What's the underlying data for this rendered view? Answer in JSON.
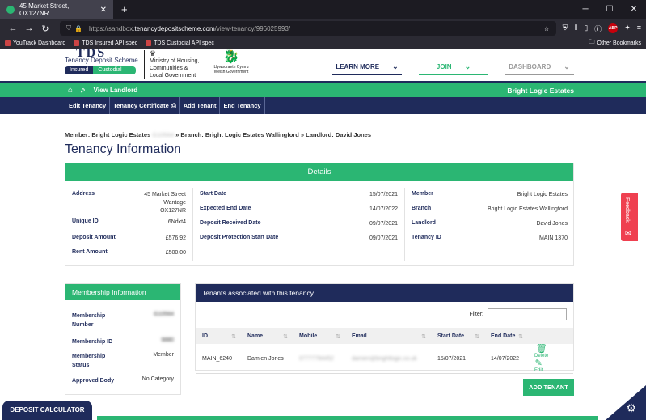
{
  "browser": {
    "tab_title": "45 Market Street, OX127NR",
    "tab_close": "✕",
    "new_tab": "+",
    "url_prefix": "https://sandbox.",
    "url_host": "tenancydepositscheme.com",
    "url_path": "/view-tenancy/996025993/",
    "bookmarks": [
      "YouTrack Dashboard",
      "TDS Insured API spec",
      "TDS Custodial API spec"
    ],
    "other_bookmarks": "Other Bookmarks"
  },
  "header": {
    "logo_text": "TDS",
    "logo_sub": "Tenancy Deposit Scheme",
    "insured": "Insured",
    "custodial": "Custodial",
    "gov_lines": [
      "Ministry of Housing,",
      "Communities &",
      "Local Government"
    ],
    "welsh_lines": [
      "Llywodraeth Cymru",
      "Welsh Government"
    ],
    "nav": {
      "learn": "LEARN MORE",
      "join": "JOIN",
      "dashboard": "DASHBOARD"
    }
  },
  "greenbar": {
    "view_landlord": "View Landlord",
    "brand": "Bright Logic Estates"
  },
  "actions": {
    "edit": "Edit Tenancy",
    "certificate": "Tenancy Certificate",
    "add": "Add Tenant",
    "end": "End Tenancy"
  },
  "breadcrumb": {
    "member_label": "Member: Bright Logic Estates",
    "member_id": "G10564",
    "branch": "» Branch: Bright Logic Estates Wallingford",
    "landlord": "» Landlord: David Jones"
  },
  "page_title": "Tenancy Information",
  "details": {
    "title": "Details",
    "address_label": "Address",
    "address_lines": [
      "45 Market Street",
      "Wantage",
      "OX127NR"
    ],
    "uid_label": "Unique ID",
    "uid": "6Ndxt4",
    "deposit_label": "Deposit Amount",
    "deposit": "£576.92",
    "rent_label": "Rent Amount",
    "rent": "£500.00",
    "start_label": "Start Date",
    "start": "15/07/2021",
    "expected_label": "Expected End Date",
    "expected": "14/07/2022",
    "received_label": "Deposit Received Date",
    "received": "09/07/2021",
    "protection_label": "Deposit Protection Start Date",
    "protection": "09/07/2021",
    "member_label": "Member",
    "member": "Bright Logic Estates",
    "branch_label": "Branch",
    "branch": "Bright Logic Estates Wallingford",
    "landlord_label": "Landlord",
    "landlord": "David Jones",
    "tenancy_label": "Tenancy ID",
    "tenancy": "MAIN 1370"
  },
  "membership": {
    "title": "Membership Information",
    "number_label_1": "Membership",
    "number_label_2": "Number",
    "number": "G10564",
    "id_label": "Membership ID",
    "id": "9880",
    "status_label_1": "Membership",
    "status_label_2": "Status",
    "status": "Member",
    "approved_label": "Approved Body",
    "approved": "No Category"
  },
  "tenants": {
    "title": "Tenants associated with this tenancy",
    "filter_label": "Filter:",
    "filter_value": "",
    "columns": [
      "ID",
      "Name",
      "Mobile",
      "Email",
      "Start Date",
      "End Date"
    ],
    "rows": [
      {
        "id": "MAIN_6240",
        "name": "Damien Jones",
        "mobile": "07777784452",
        "email": "damien@brightlogic.co.uk",
        "start": "15/07/2021",
        "end": "14/07/2022"
      }
    ],
    "delete": "Delete",
    "edit": "Edit",
    "add_button": "ADD TENANT"
  },
  "deposit_calculator": "DEPOSIT CALCULATOR",
  "feedback": "Feedback",
  "colors": {
    "green": "#2bb673",
    "navy": "#1f2b5b"
  }
}
